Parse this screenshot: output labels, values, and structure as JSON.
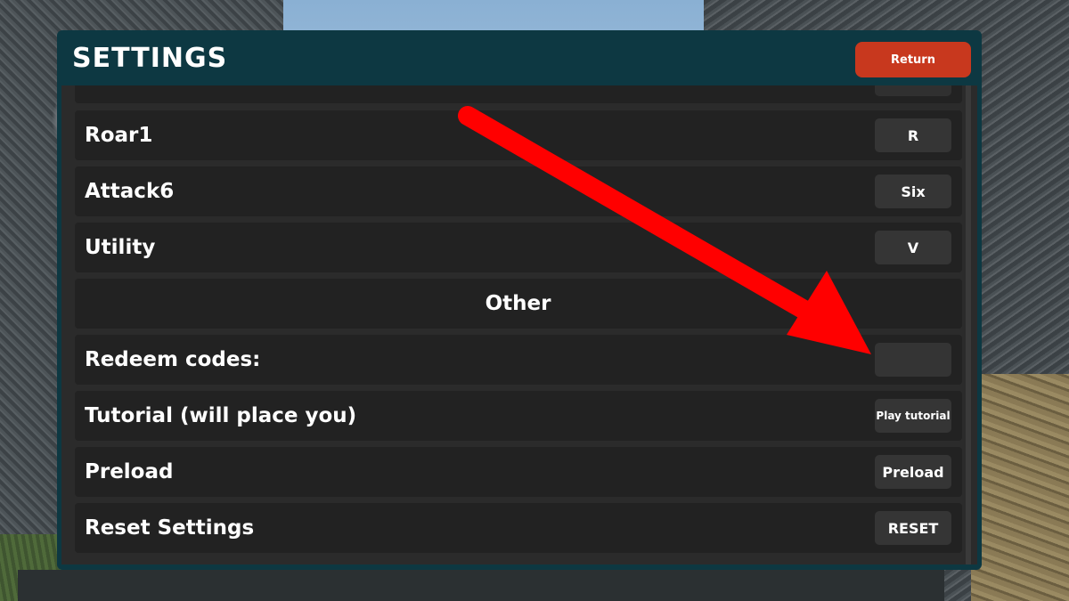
{
  "settings": {
    "title": "SETTINGS",
    "return_label": "Return"
  },
  "rows": [
    {
      "label": "Roar1",
      "button": "R"
    },
    {
      "label": "Attack6",
      "button": "Six"
    },
    {
      "label": "Utility",
      "button": "V"
    }
  ],
  "section": {
    "label": "Other"
  },
  "other_rows": [
    {
      "label": "Redeem codes:",
      "button": ""
    },
    {
      "label": "Tutorial (will place you)",
      "button": "Play tutorial"
    },
    {
      "label": "Preload",
      "button": "Preload"
    },
    {
      "label": "Reset Settings",
      "button": "RESET"
    }
  ],
  "colors": {
    "panel": "#0d3842",
    "return_button": "#c8381e",
    "row_bg": "#222222",
    "key_button": "#353535",
    "arrow": "#ff0000"
  }
}
